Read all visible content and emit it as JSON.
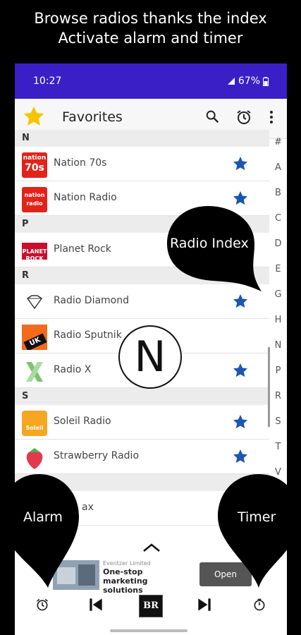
{
  "captions": {
    "line1": "Browse radios thanks the index",
    "line2": "Activate alarm and timer"
  },
  "statusbar": {
    "time": "10:27",
    "battery": "67%"
  },
  "appbar": {
    "title": "Favorites",
    "icons": [
      "star-icon",
      "search-icon",
      "alarm-icon",
      "more-vert-icon"
    ]
  },
  "sections": {
    "n": "N",
    "p": "P",
    "r": "R",
    "s": "S"
  },
  "radios": {
    "nation70s": "Nation 70s",
    "nationradio": "Nation Radio",
    "planetrock": "Planet Rock",
    "radiodiamond": "Radio Diamond",
    "radiosputnik": "Radio Sputnik",
    "radiox": "Radio X",
    "soleil": "Soleil Radio",
    "strawberry": "Strawberry Radio",
    "partial": "ax"
  },
  "logo_text": {
    "nation70s": "nation",
    "nation70s_big": "70s",
    "nationradio": "nation radio",
    "planetrock": "PLANET ROCK",
    "sputnik": "UK",
    "soleil": "Soleil"
  },
  "index_letters": [
    "#",
    "A",
    "B",
    "C",
    "D",
    "E",
    "G",
    "H",
    "N",
    "P",
    "R",
    "S",
    "T",
    "V"
  ],
  "overlay": {
    "letter": "N",
    "radio_index": "Radio Index",
    "alarm": "Alarm",
    "timer": "Timer"
  },
  "ad": {
    "advertiser": "Eventzer Limited",
    "headline": "One-stop marketing solutions",
    "cta": "Open"
  },
  "player": {
    "logo": "BR"
  },
  "colors": {
    "accent": "#3b1fc6",
    "star": "#1a56b4",
    "header_star": "#f6c400"
  }
}
